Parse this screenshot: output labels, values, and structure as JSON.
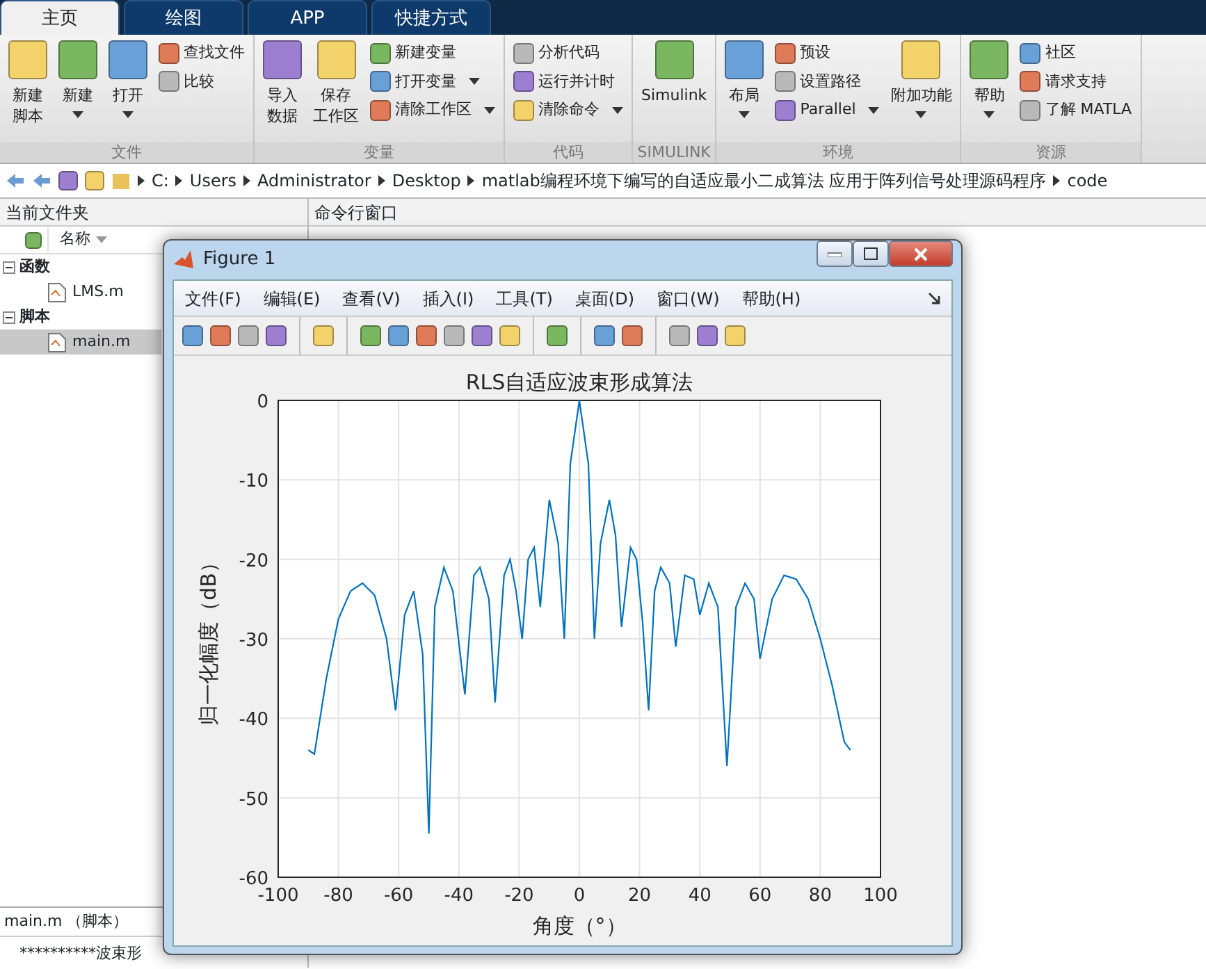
{
  "tabs": [
    {
      "label": "主页",
      "selected": true
    },
    {
      "label": "绘图",
      "selected": false
    },
    {
      "label": "APP",
      "selected": false
    },
    {
      "label": "快捷方式",
      "selected": false
    }
  ],
  "ribbon": {
    "groups": [
      {
        "label": "文件",
        "items": [
          {
            "kind": "large",
            "lines": [
              "新建",
              "脚本"
            ],
            "dropdown": false
          },
          {
            "kind": "large",
            "lines": [
              "新建"
            ],
            "dropdown": true
          },
          {
            "kind": "large",
            "lines": [
              "打开"
            ],
            "dropdown": true
          },
          {
            "kind": "stack",
            "entries": [
              {
                "label": "查找文件",
                "dropdown": false
              },
              {
                "label": "比较",
                "dropdown": false
              }
            ]
          }
        ]
      },
      {
        "label": "变量",
        "items": [
          {
            "kind": "large",
            "lines": [
              "导入",
              "数据"
            ],
            "dropdown": false
          },
          {
            "kind": "large",
            "lines": [
              "保存",
              "工作区"
            ],
            "dropdown": false
          },
          {
            "kind": "stack",
            "entries": [
              {
                "label": "新建变量",
                "dropdown": false
              },
              {
                "label": "打开变量",
                "dropdown": true
              },
              {
                "label": "清除工作区",
                "dropdown": true
              }
            ]
          }
        ]
      },
      {
        "label": "代码",
        "items": [
          {
            "kind": "stack",
            "entries": [
              {
                "label": "分析代码",
                "dropdown": false
              },
              {
                "label": "运行并计时",
                "dropdown": false
              },
              {
                "label": "清除命令",
                "dropdown": true
              }
            ]
          }
        ]
      },
      {
        "label": "SIMULINK",
        "items": [
          {
            "kind": "large",
            "lines": [
              "Simulink"
            ],
            "dropdown": false
          }
        ]
      },
      {
        "label": "环境",
        "items": [
          {
            "kind": "large",
            "lines": [
              "布局"
            ],
            "dropdown": true
          },
          {
            "kind": "stack",
            "entries": [
              {
                "label": "预设",
                "dropdown": false
              },
              {
                "label": "设置路径",
                "dropdown": false
              },
              {
                "label": "Parallel",
                "dropdown": true
              }
            ]
          },
          {
            "kind": "large",
            "lines": [
              "附加功能"
            ],
            "dropdown": true
          }
        ]
      },
      {
        "label": "资源",
        "items": [
          {
            "kind": "large",
            "lines": [
              "帮助"
            ],
            "dropdown": true
          },
          {
            "kind": "stack",
            "entries": [
              {
                "label": "社区",
                "dropdown": false
              },
              {
                "label": "请求支持",
                "dropdown": false
              },
              {
                "label": "了解 MATLA",
                "dropdown": false
              }
            ]
          }
        ]
      }
    ]
  },
  "address": [
    "C:",
    "Users",
    "Administrator",
    "Desktop",
    "matlab编程环境下编写的自适应最小二成算法 应用于阵列信号处理源码程序",
    "code"
  ],
  "file_panel": {
    "title": "当前文件夹",
    "column": "名称",
    "groups": [
      {
        "label": "函数",
        "expanded": true,
        "children": [
          {
            "label": "LMS.m",
            "selected": false
          }
        ]
      },
      {
        "label": "脚本",
        "expanded": true,
        "children": [
          {
            "label": "main.m",
            "selected": true
          }
        ]
      }
    ],
    "details_title": "main.m （脚本）",
    "details_text": "**********波束形"
  },
  "command_window": {
    "title": "命令行窗口"
  },
  "figure": {
    "title": "Figure 1",
    "menus": [
      "文件(F)",
      "编辑(E)",
      "查看(V)",
      "插入(I)",
      "工具(T)",
      "桌面(D)",
      "窗口(W)",
      "帮助(H)"
    ],
    "chart_data": {
      "type": "line",
      "title": "RLS自适应波束形成算法",
      "xlabel": "角度（°）",
      "ylabel": "归一化幅度（dB）",
      "xlim": [
        -100,
        100
      ],
      "ylim": [
        -60,
        0
      ],
      "xticks": [
        -100,
        -80,
        -60,
        -40,
        -20,
        0,
        20,
        40,
        60,
        80,
        100
      ],
      "yticks": [
        -60,
        -50,
        -40,
        -30,
        -20,
        -10,
        0
      ],
      "x": [
        -90,
        -88,
        -84,
        -80,
        -76,
        -72,
        -68,
        -64,
        -61,
        -58,
        -55,
        -52,
        -50,
        -48,
        -45,
        -42,
        -38,
        -35,
        -33,
        -30,
        -28,
        -25,
        -23,
        -21,
        -19,
        -17,
        -15,
        -13,
        -10,
        -7,
        -5,
        -3,
        0,
        3,
        5,
        7,
        10,
        12,
        14,
        17,
        19,
        21,
        23,
        25,
        27,
        30,
        32,
        35,
        38,
        40,
        43,
        46,
        49,
        52,
        55,
        58,
        60,
        64,
        68,
        72,
        76,
        80,
        84,
        88,
        90
      ],
      "grid": true,
      "series": [
        {
          "color": "#0072bd",
          "values": [
            -44,
            -44.5,
            -35,
            -27.5,
            -24,
            -23,
            -24.5,
            -30,
            -39,
            -27,
            -24,
            -32,
            -54.5,
            -26,
            -21,
            -24,
            -37,
            -22,
            -21,
            -25,
            -38,
            -22,
            -20,
            -24,
            -30,
            -20,
            -18.5,
            -26,
            -12.5,
            -18,
            -30,
            -8,
            0,
            -8,
            -30,
            -18,
            -12.5,
            -17,
            -28.5,
            -18.5,
            -20,
            -28,
            -39,
            -24,
            -21,
            -23,
            -31,
            -22,
            -22.5,
            -27,
            -23,
            -26,
            -46,
            -26,
            -23,
            -25,
            -32.5,
            -25,
            -22,
            -22.5,
            -25,
            -30,
            -36,
            -43,
            -44
          ]
        }
      ]
    }
  }
}
